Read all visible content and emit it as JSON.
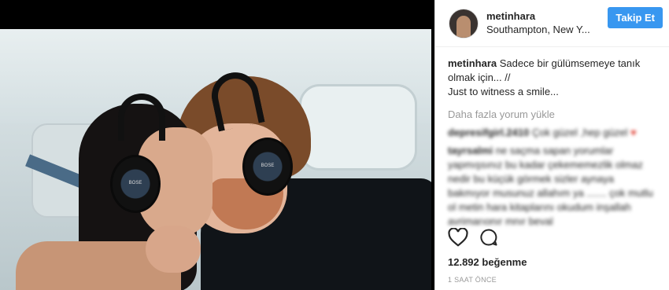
{
  "post": {
    "username": "metinhara",
    "location": "Southampton, New Y...",
    "follow_label": "Takip Et",
    "caption_user": "metinhara",
    "caption_text": "Sadece bir gülümsemeye tanık olmak için... //",
    "caption_text_2": "Just to witness a smile...",
    "load_more": "Daha fazla yorum yükle",
    "likes": "12.892 beğenme",
    "time": "1 SAAT ÖNCE"
  },
  "comments": [
    {
      "user": "depresifgirl.2410",
      "text": "Çok güzel ,hep güzel"
    },
    {
      "user": "tayrsalmi",
      "text": "ne saçma sapan yorumlar yapmışsınız bu kadar çekememezlik olmaz nedir bu küçük görmek sizler aynaya bakmıyor musunuz allahım ya ....... çok mutlu ol metin hara kitaplarını okudum inşallah avrimarıonır mnır beval"
    }
  ],
  "photo": {
    "headset_brand": "BOSE"
  },
  "colors": {
    "accent": "#3897f0",
    "text": "#262626",
    "muted": "#999999"
  },
  "icons": [
    "heart-icon",
    "comment-icon"
  ]
}
